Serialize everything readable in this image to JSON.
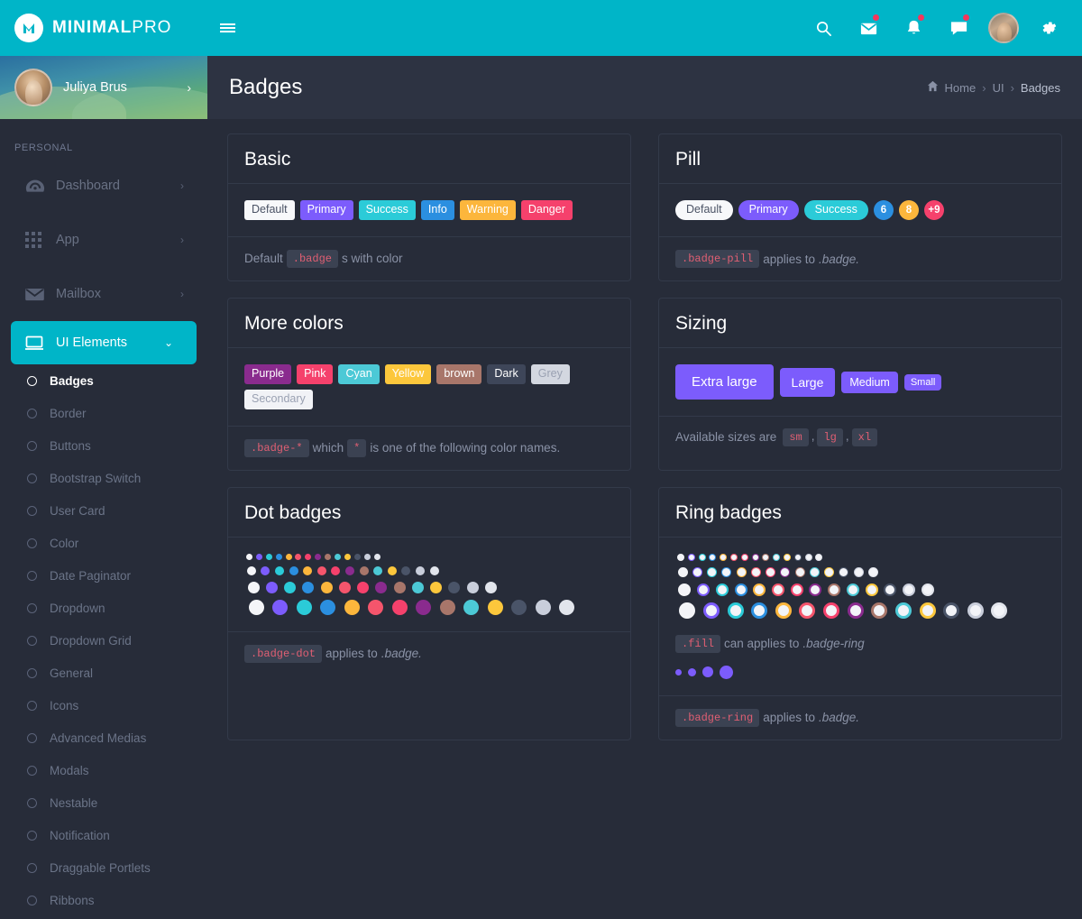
{
  "brand": {
    "name_bold": "MINIMAL",
    "name_light": "PRO",
    "logo_icon": "m-logo-icon"
  },
  "topbar": {
    "menu_toggle": "hamburger-icon",
    "icons": [
      {
        "name": "search-icon",
        "badge": false
      },
      {
        "name": "mail-icon",
        "badge": true
      },
      {
        "name": "bell-icon",
        "badge": true
      },
      {
        "name": "chat-icon",
        "badge": true
      }
    ],
    "avatar": "user-avatar",
    "settings": "gear-icon"
  },
  "sidebar": {
    "profile": {
      "name": "Juliya Brus",
      "arrow": "›"
    },
    "section_label": "PERSONAL",
    "groups": [
      {
        "label": "Dashboard",
        "icon": "speedometer-icon",
        "chev": "›",
        "active": false
      },
      {
        "label": "App",
        "icon": "grid-icon",
        "chev": "›",
        "active": false
      },
      {
        "label": "Mailbox",
        "icon": "envelope-icon",
        "chev": "›",
        "active": false
      },
      {
        "label": "UI Elements",
        "icon": "monitor-icon",
        "chev": "⌄",
        "active": true
      }
    ],
    "sub_items": [
      {
        "label": "Badges",
        "current": true
      },
      {
        "label": "Border",
        "current": false
      },
      {
        "label": "Buttons",
        "current": false
      },
      {
        "label": "Bootstrap Switch",
        "current": false
      },
      {
        "label": "User Card",
        "current": false
      },
      {
        "label": "Color",
        "current": false
      },
      {
        "label": "Date Paginator",
        "current": false
      },
      {
        "label": "Dropdown",
        "current": false
      },
      {
        "label": "Dropdown Grid",
        "current": false
      },
      {
        "label": "General",
        "current": false
      },
      {
        "label": "Icons",
        "current": false
      },
      {
        "label": "Advanced Medias",
        "current": false
      },
      {
        "label": "Modals",
        "current": false
      },
      {
        "label": "Nestable",
        "current": false
      },
      {
        "label": "Notification",
        "current": false
      },
      {
        "label": "Draggable Portlets",
        "current": false
      },
      {
        "label": "Ribbons",
        "current": false
      }
    ]
  },
  "page": {
    "title": "Badges",
    "breadcrumb": {
      "home_icon": "home-icon",
      "home": "Home",
      "sep": "›",
      "mid": "UI",
      "current": "Badges"
    }
  },
  "cards": {
    "basic": {
      "title": "Basic",
      "badges": [
        {
          "label": "Default",
          "bg": "#f7f8fa",
          "color": "#4a5264"
        },
        {
          "label": "Primary",
          "bg": "#7c5cfc",
          "color": "#ffffff"
        },
        {
          "label": "Success",
          "bg": "#2bcbd8",
          "color": "#ffffff"
        },
        {
          "label": "Info",
          "bg": "#2b8fe0",
          "color": "#ffffff"
        },
        {
          "label": "Warning",
          "bg": "#fcb63c",
          "color": "#ffffff"
        },
        {
          "label": "Danger",
          "bg": "#f5416c",
          "color": "#ffffff"
        }
      ],
      "footer": {
        "pre": "Default",
        "code": ".badge",
        "post": "s with color"
      }
    },
    "pill": {
      "title": "Pill",
      "badges": [
        {
          "label": "Default",
          "bg": "#f7f8fa",
          "color": "#4a5264",
          "shape": "pill"
        },
        {
          "label": "Primary",
          "bg": "#7c5cfc",
          "color": "#ffffff",
          "shape": "pill"
        },
        {
          "label": "Success",
          "bg": "#2bcbd8",
          "color": "#ffffff",
          "shape": "pill"
        },
        {
          "label": "6",
          "bg": "#2b8fe0",
          "color": "#ffffff",
          "shape": "circle"
        },
        {
          "label": "8",
          "bg": "#fcb63c",
          "color": "#ffffff",
          "shape": "circle"
        },
        {
          "label": "+9",
          "bg": "#f5416c",
          "color": "#ffffff",
          "shape": "circle"
        }
      ],
      "footer": {
        "code": ".badge-pill",
        "post": "applies to",
        "italic": ".badge."
      }
    },
    "more_colors": {
      "title": "More colors",
      "badges": [
        {
          "label": "Purple",
          "bg": "#8a2b8e",
          "color": "#ffffff"
        },
        {
          "label": "Pink",
          "bg": "#f5416c",
          "color": "#ffffff"
        },
        {
          "label": "Cyan",
          "bg": "#4cc9d6",
          "color": "#ffffff"
        },
        {
          "label": "Yellow",
          "bg": "#fcc73c",
          "color": "#ffffff"
        },
        {
          "label": "brown",
          "bg": "#a8766a",
          "color": "#ffffff"
        },
        {
          "label": "Dark",
          "bg": "#3e4659",
          "color": "#ffffff"
        },
        {
          "label": "Grey",
          "bg": "#d3d7e0",
          "color": "#9aa1b2"
        },
        {
          "label": "Secondary",
          "bg": "#f1f2f6",
          "color": "#9aa1b2"
        }
      ],
      "footer": {
        "code1": ".badge-*",
        "mid": "which",
        "code2": "*",
        "post": "is one of the following color names."
      }
    },
    "sizing": {
      "title": "Sizing",
      "badges": [
        {
          "label": "Extra large",
          "size": "xl"
        },
        {
          "label": "Large",
          "size": "lg"
        },
        {
          "label": "Medium",
          "size": "md"
        },
        {
          "label": "Small",
          "size": "sm"
        }
      ],
      "accent": "#7c5cfc",
      "footer": {
        "pre": "Available sizes are",
        "codes": [
          "sm",
          "lg",
          "xl"
        ],
        "sep": ","
      }
    },
    "dot_badges": {
      "title": "Dot badges",
      "palette": [
        "#f4f5f8",
        "#7c5cfc",
        "#2bcbd8",
        "#2b8fe0",
        "#fcb63c",
        "#f5556c",
        "#f5416c",
        "#8a2b8e",
        "#a8766a",
        "#4cc9d6",
        "#fcc73c",
        "#4a5468",
        "#c9cedb",
        "#e2e5ec"
      ],
      "row_sizes": [
        7,
        10,
        13,
        17
      ],
      "footer": {
        "code": ".badge-dot",
        "post": "applies to",
        "italic": ".badge."
      }
    },
    "ring_badges": {
      "title": "Ring badges",
      "palette": [
        "#f4f5f8",
        "#7c5cfc",
        "#2bcbd8",
        "#2b8fe0",
        "#fcb63c",
        "#f5556c",
        "#f5416c",
        "#8a2b8e",
        "#a8766a",
        "#4cc9d6",
        "#fcc73c",
        "#4a5468",
        "#c9cedb",
        "#e2e5ec"
      ],
      "row_sizes": [
        8,
        11,
        14,
        18
      ],
      "fill_note": {
        "code": ".fill",
        "post": "can applies to",
        "italic": ".badge-ring"
      },
      "fill_color": "#7c5cfc",
      "fill_sizes": [
        7,
        9,
        12,
        15
      ],
      "footer": {
        "code": ".badge-ring",
        "post": "applies to",
        "italic": ".badge."
      }
    }
  }
}
